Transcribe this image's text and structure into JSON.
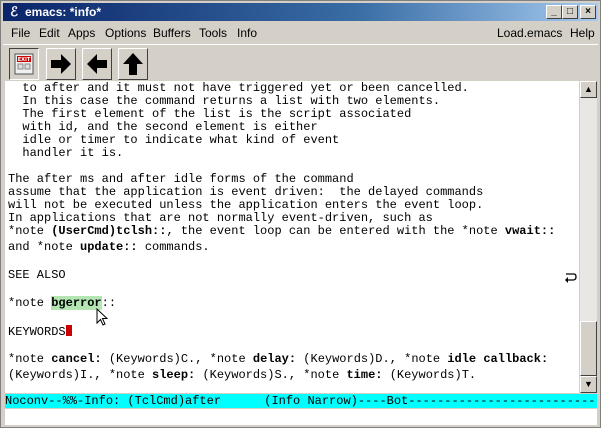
{
  "window": {
    "title": "emacs: *info*",
    "minimize": "_",
    "maximize": "□",
    "close": "×"
  },
  "menu": {
    "items": [
      "File",
      "Edit",
      "Apps",
      "Options",
      "Buffers",
      "Tools",
      "Info"
    ],
    "right": [
      "Load.emacs",
      "Help"
    ]
  },
  "toolbar": {
    "icons": [
      "exit-icon",
      "arrow-right-icon",
      "arrow-left-icon",
      "arrow-up-icon"
    ],
    "exit_label": "EXIT"
  },
  "buffer": {
    "lines": [
      "  to after and it must not have triggered yet or been cancelled.",
      "  In this case the command returns a list with two elements.",
      "  The first element of the list is the script associated",
      "  with id, and the second element is either",
      "  idle or timer to indicate what kind of event",
      "  handler it is.",
      "",
      "The after ms and after idle forms of the command",
      "assume that the application is event driven:  the delayed commands",
      "will not be executed unless the application enters the event loop.",
      "In applications that are not normally event-driven, such as"
    ],
    "line_tclsh": {
      "a": "*note ",
      "b": "(UserCmd)tclsh::",
      "c": ", the event loop can be entered with the *note ",
      "d": "vwait::"
    },
    "line_update": {
      "a": "and *note ",
      "b": "update::",
      "c": " commands."
    },
    "see_also": "SEE ALSO",
    "note_bgerror": {
      "a": "*note ",
      "b": "bgerror",
      "c": "::"
    },
    "keywords": "KEYWORDS",
    "kw_line1": {
      "a": "*note ",
      "b": "cancel:",
      "c": " (Keywords)C., *note ",
      "d": "delay:",
      "e": " (Keywords)D., *note ",
      "f": "idle callback:"
    },
    "kw_line2": {
      "a": "(Keywords)I., *note ",
      "b": "sleep:",
      "c": " (Keywords)S., *note ",
      "d": "time:",
      "e": " (Keywords)T."
    }
  },
  "modeline": "Noconv--%%-Info: (TclCmd)after      (Info Narrow)----Bot---------------------------",
  "scrollbar": {
    "up": "▲",
    "down": "▼",
    "position_fraction": 0.8
  }
}
